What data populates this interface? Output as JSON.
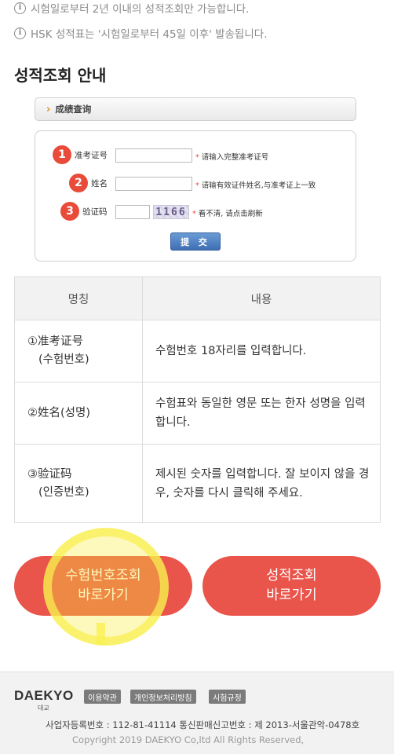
{
  "notices": [
    "시험일로부터 2년 이내의 성적조회만 가능합니다.",
    "HSK 성적표는 '시험일로부터 45일 이후' 발송됩니다."
  ],
  "info_icon": "i",
  "section_title": "성적조회 안내",
  "form": {
    "header": "成绩查询",
    "rows": [
      {
        "num": "1",
        "label": "准考证号",
        "hint": "请输入完整准考证号"
      },
      {
        "num": "2",
        "label": "姓名",
        "hint": "请输有效证件姓名,与准考证上一致"
      },
      {
        "num": "3",
        "label": "验证码",
        "captcha": "1166",
        "hint": "看不清, 请点击刷新"
      }
    ],
    "hint_star": "*",
    "submit": "提 交"
  },
  "table": {
    "headers": [
      "명칭",
      "내용"
    ],
    "rows": [
      {
        "name_line1": "①准考证号",
        "name_line2": "(수험번호)",
        "content": "수험번호 18자리를 입력합니다."
      },
      {
        "name_line1": "②姓名(성명)",
        "name_line2": "",
        "content": "수험표와 동일한 영문 또는 한자 성명을 입력합니다."
      },
      {
        "name_line1": "③验证码",
        "name_line2": "(인증번호)",
        "content": "제시된 숫자를 입력합니다. 잘 보이지 않을 경우, 숫자를 다시 클릭해 주세요."
      }
    ]
  },
  "buttons": {
    "left_line1": "수험번호조회",
    "left_line2": "바로가기",
    "right_line1": "성적조회",
    "right_line2": "바로가기",
    "color": "#e9544b"
  },
  "footer": {
    "logo": "DAEKYO",
    "logo_sub": "대교",
    "links": [
      "이용약관",
      "개인정보처리방침",
      "시험규정"
    ],
    "business": "사업자등록번호 : 112-81-41114    통신판매신고번호 : 제 2013-서울관악-0478호",
    "copyright": "Copyright 2019 DAEKYO Co,ltd All Rights Reserved,"
  }
}
